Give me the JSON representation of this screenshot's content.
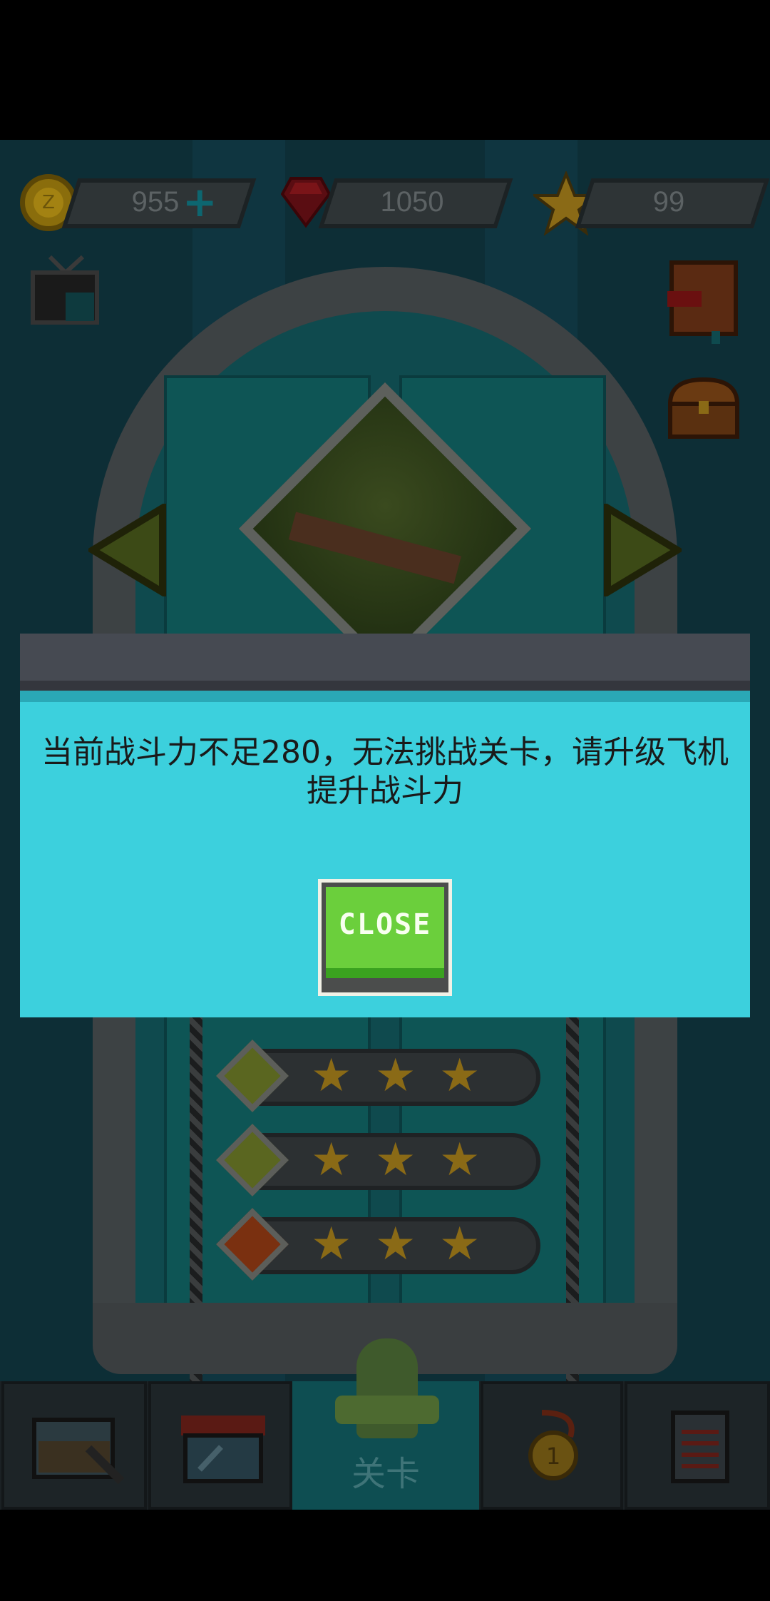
{
  "resources": {
    "coins": "955",
    "gems": "1050",
    "stars": "99",
    "coin_icon_label": "Z"
  },
  "nav": {
    "active_label": "关卡"
  },
  "dialog": {
    "message": "当前战斗力不足280，无法挑战关卡，请升级飞机提升战斗力",
    "close_label": "CLOSE"
  },
  "levels": [
    {
      "stars": 3,
      "gem_color": "#5a6620"
    },
    {
      "stars": 3,
      "gem_color": "#5a6620"
    },
    {
      "stars": 3,
      "gem_color": "#7a3010"
    }
  ],
  "colors": {
    "dialog_bg": "#3cd0dd",
    "close_button": "#6bcf3c"
  },
  "icons": [
    "coin-icon",
    "plus-icon",
    "gem-icon",
    "star-icon",
    "tv-icon",
    "book-icon",
    "chest-icon",
    "arrow-left-icon",
    "arrow-right-icon",
    "hangar-icon",
    "shop-icon",
    "medal-icon",
    "list-icon"
  ]
}
